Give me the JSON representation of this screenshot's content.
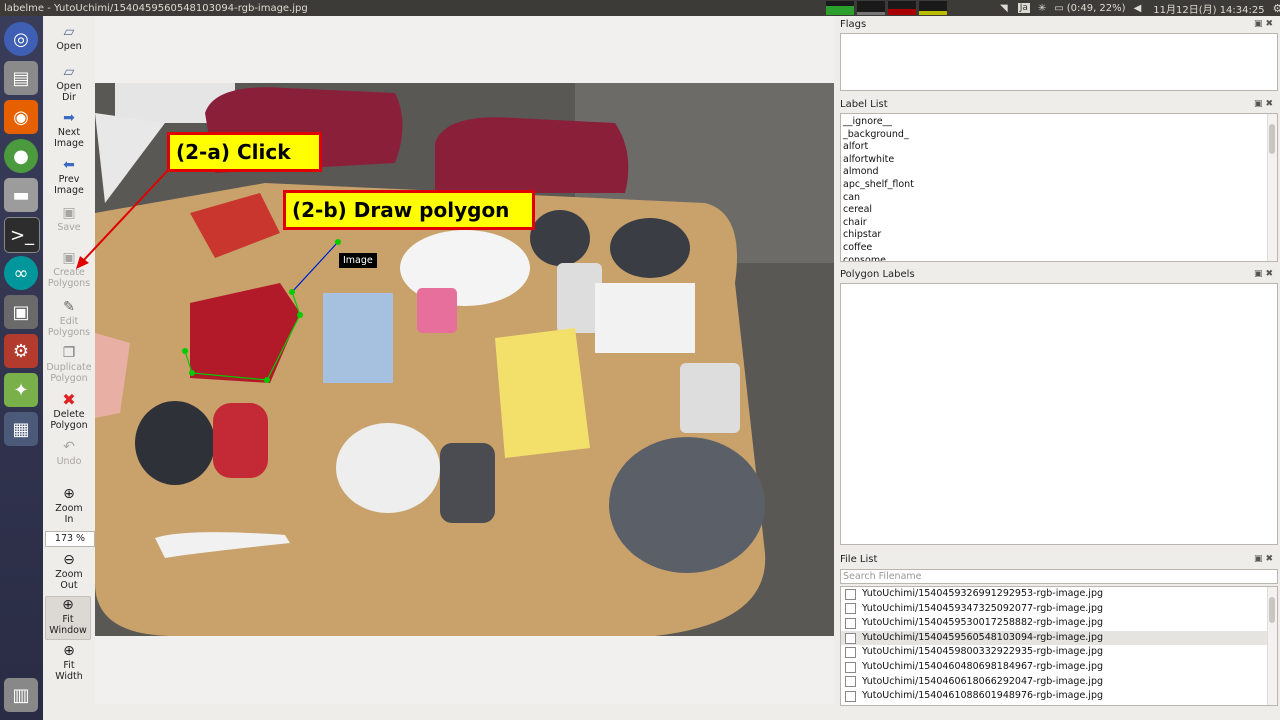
{
  "window": {
    "title": "labelme - YutoUchimi/1540459560548103094-rgb-image.jpg"
  },
  "tray": {
    "lang": "Ja",
    "battery": "(0:49, 22%)",
    "datetime": "11月12日(月) 14:34:25"
  },
  "toolbar": {
    "open": "Open",
    "open_dir": [
      "Open",
      "Dir"
    ],
    "next_image": [
      "Next",
      "Image"
    ],
    "prev_image": [
      "Prev",
      "Image"
    ],
    "save": "Save",
    "create_polygons": [
      "Create",
      "Polygons"
    ],
    "edit_polygons": [
      "Edit",
      "Polygons"
    ],
    "duplicate_polygon": [
      "Duplicate",
      "Polygon"
    ],
    "delete_polygon": [
      "Delete",
      "Polygon"
    ],
    "undo": "Undo",
    "zoom_in": [
      "Zoom",
      "In"
    ],
    "zoom_value": "173 %",
    "zoom_out": [
      "Zoom",
      "Out"
    ],
    "fit_window": [
      "Fit",
      "Window"
    ],
    "fit_width": [
      "Fit",
      "Width"
    ]
  },
  "annotations": {
    "click": "(2-a) Click",
    "draw": "(2-b) Draw polygon"
  },
  "canvas": {
    "tooltip": "Image"
  },
  "docks": {
    "flags_title": "Flags",
    "label_list_title": "Label List",
    "polygon_labels_title": "Polygon Labels",
    "file_list_title": "File List",
    "search_placeholder": "Search Filename"
  },
  "labels": [
    "__ignore__",
    "_background_",
    "alfort",
    "alfortwhite",
    "almond",
    "apc_shelf_flont",
    "can",
    "cereal",
    "chair",
    "chipstar",
    "coffee",
    "consome"
  ],
  "files": [
    "YutoUchimi/1540459326991292953-rgb-image.jpg",
    "YutoUchimi/1540459347325092077-rgb-image.jpg",
    "YutoUchimi/1540459530017258882-rgb-image.jpg",
    "YutoUchimi/1540459560548103094-rgb-image.jpg",
    "YutoUchimi/1540459800332922935-rgb-image.jpg",
    "YutoUchimi/1540460480698184967-rgb-image.jpg",
    "YutoUchimi/1540460618066292047-rgb-image.jpg",
    "YutoUchimi/1540461088601948976-rgb-image.jpg"
  ],
  "selected_file_index": 3,
  "colors": {
    "accent_red": "#e00000",
    "annotation_bg": "#ffff00",
    "polygon_line": "#00cc00",
    "cursor_line": "#0000ff"
  }
}
